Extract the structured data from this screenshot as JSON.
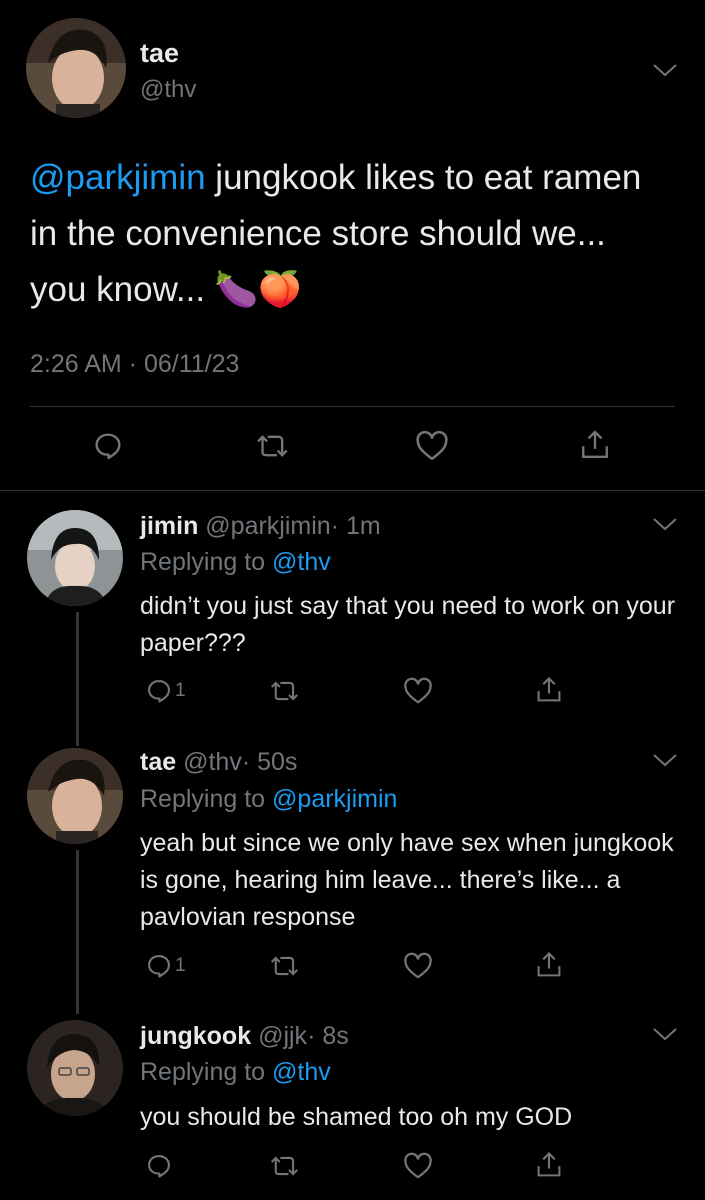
{
  "main_tweet": {
    "author": {
      "name": "tae",
      "handle": "@thv"
    },
    "mention": "@parkjimin",
    "text": " jungkook likes to eat ramen in the convenience store should we... you know... 🍆🍑",
    "timestamp": "2:26 AM · 06/11/23",
    "actions": [
      "reply-icon",
      "retweet-icon",
      "like-icon",
      "share-icon"
    ]
  },
  "replies": [
    {
      "name": "jimin",
      "handle": "@parkjimin",
      "time": "· 1m",
      "replying_prefix": "Replying to ",
      "replying_to": "@thv",
      "text": "didn’t you just say that you need to work on your paper???",
      "reply_count": "1"
    },
    {
      "name": "tae",
      "handle": "@thv",
      "time": "· 50s",
      "replying_prefix": "Replying to ",
      "replying_to": "@parkjimin",
      "text": "yeah but since we only have sex when jungkook is gone, hearing him leave... there’s like... a pavlovian response",
      "reply_count": "1"
    },
    {
      "name": "jungkook",
      "handle": "@jjk",
      "time": "· 8s",
      "replying_prefix": "Replying to ",
      "replying_to": "@thv",
      "text": "you should be shamed too oh my GOD",
      "reply_count": ""
    }
  ],
  "colors": {
    "background": "#000000",
    "text": "#e7e9ea",
    "muted": "#71767b",
    "link": "#1d9bf0",
    "divider": "#2f3336"
  }
}
